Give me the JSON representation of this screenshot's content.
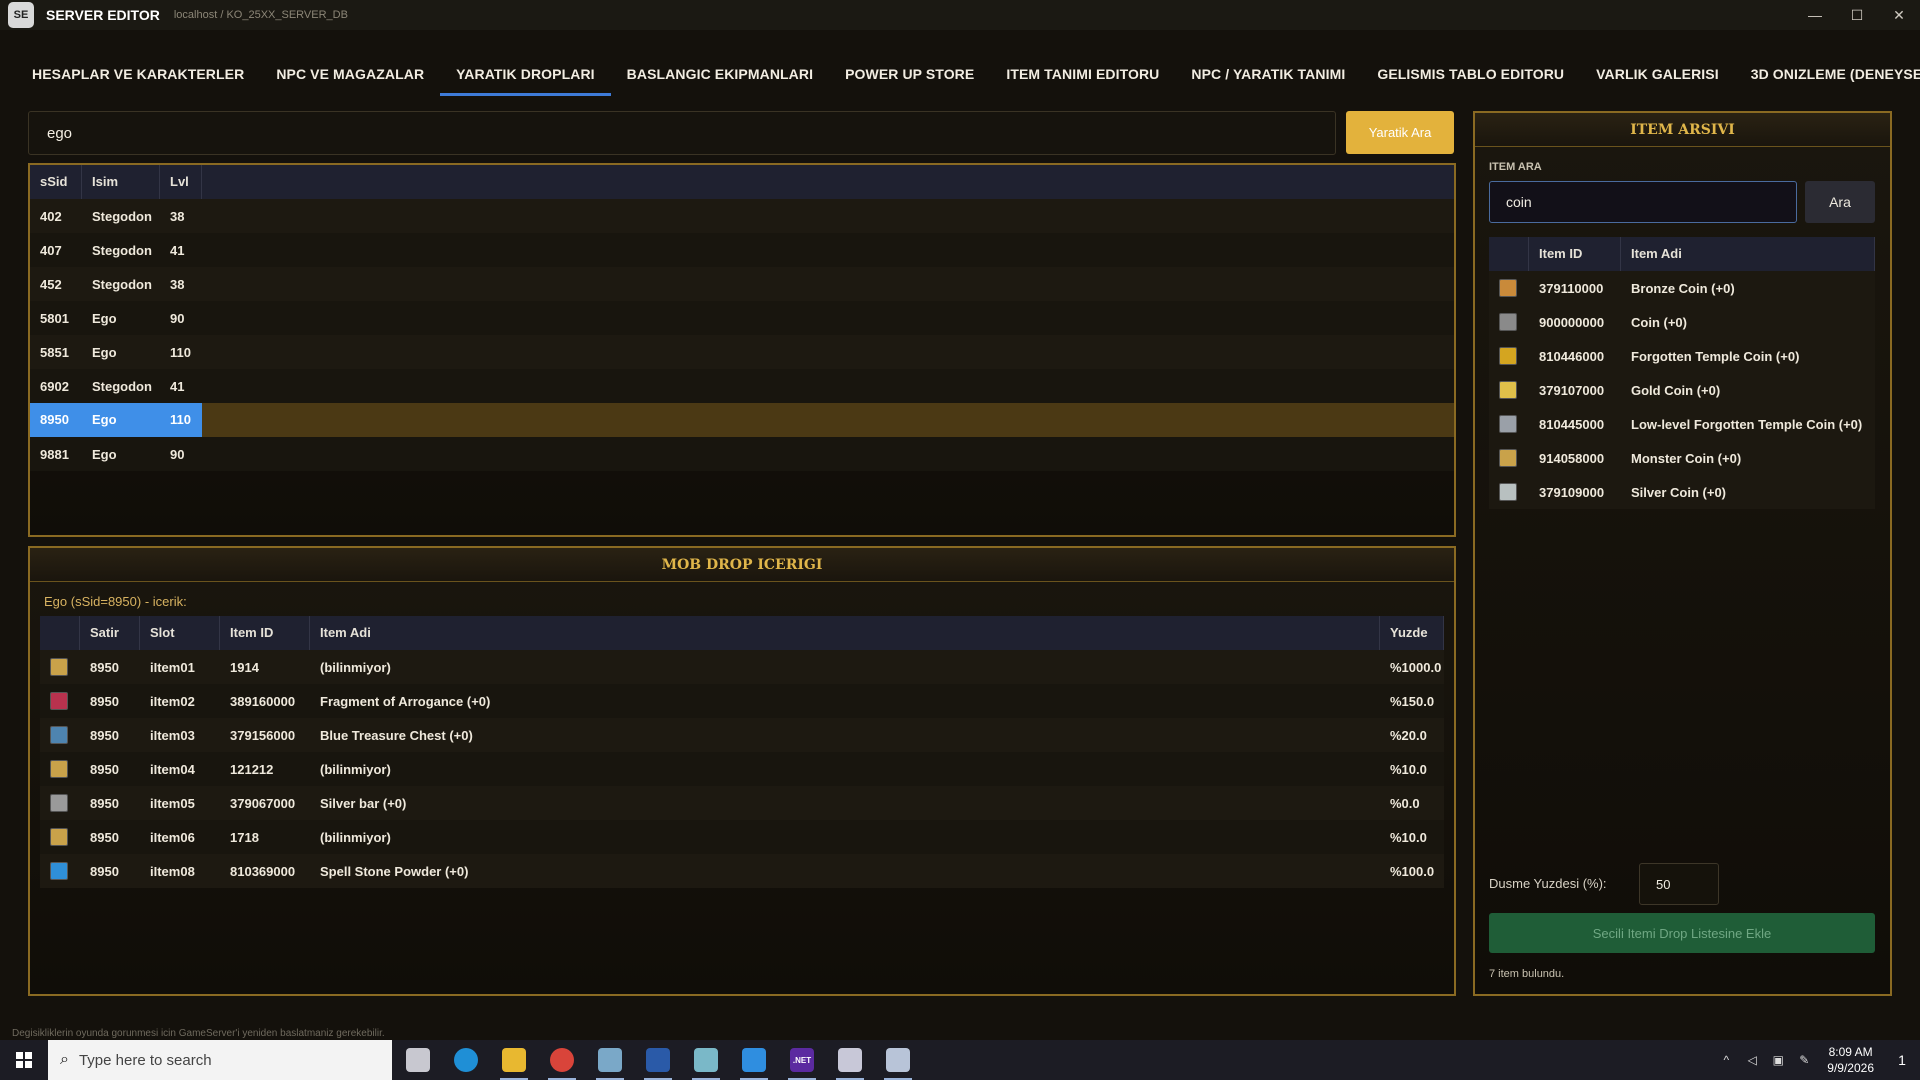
{
  "titlebar": {
    "badge": "SE",
    "title": "SERVER EDITOR",
    "path": "localhost / KO_25XX_SERVER_DB",
    "minimize": "—",
    "maximize": "☐",
    "close": "✕"
  },
  "tabs": [
    {
      "label": "HESAPLAR VE KARAKTERLER",
      "active": false
    },
    {
      "label": "NPC VE MAGAZALAR",
      "active": false
    },
    {
      "label": "YARATIK DROPLARI",
      "active": true
    },
    {
      "label": "BASLANGIC EKIPMANLARI",
      "active": false
    },
    {
      "label": "POWER UP STORE",
      "active": false
    },
    {
      "label": "ITEM TANIMI EDITORU",
      "active": false
    },
    {
      "label": "NPC / YARATIK TANIMI",
      "active": false
    },
    {
      "label": "GELISMIS TABLO EDITORU",
      "active": false
    },
    {
      "label": "VARLIK GALERISI",
      "active": false
    },
    {
      "label": "3D ONIZLEME (DENEYSEL)",
      "active": false
    }
  ],
  "mob_search": {
    "value": "ego",
    "button": "Yaratik Ara"
  },
  "mob_table": {
    "headers": [
      "sSid",
      "Isim",
      "Lvl"
    ],
    "rows": [
      {
        "sid": "402",
        "name": "Stegodon",
        "lvl": "38",
        "selected": false
      },
      {
        "sid": "407",
        "name": "Stegodon",
        "lvl": "41",
        "selected": false
      },
      {
        "sid": "452",
        "name": "Stegodon",
        "lvl": "38",
        "selected": false
      },
      {
        "sid": "5801",
        "name": "Ego",
        "lvl": "90",
        "selected": false
      },
      {
        "sid": "5851",
        "name": "Ego",
        "lvl": "110",
        "selected": false
      },
      {
        "sid": "6902",
        "name": "Stegodon",
        "lvl": "41",
        "selected": false
      },
      {
        "sid": "8950",
        "name": "Ego",
        "lvl": "110",
        "selected": true
      },
      {
        "sid": "9881",
        "name": "Ego",
        "lvl": "90",
        "selected": false
      }
    ]
  },
  "drop_panel": {
    "title": "MOB DROP ICERIGI",
    "caption": "Ego (sSid=8950) - icerik:",
    "headers": [
      "",
      "Satir",
      "Slot",
      "Item ID",
      "Item Adi",
      "Yuzde"
    ],
    "rows": [
      {
        "icon_color": "#c9a24a",
        "row": "8950",
        "slot": "iItem01",
        "item_id": "1914",
        "item_name": "(bilinmiyor)",
        "pct": "%1000.0"
      },
      {
        "icon_color": "#b8324e",
        "row": "8950",
        "slot": "iItem02",
        "item_id": "389160000",
        "item_name": "Fragment of Arrogance (+0)",
        "pct": "%150.0"
      },
      {
        "icon_color": "#4e84b0",
        "row": "8950",
        "slot": "iItem03",
        "item_id": "379156000",
        "item_name": "Blue Treasure Chest (+0)",
        "pct": "%20.0"
      },
      {
        "icon_color": "#c9a24a",
        "row": "8950",
        "slot": "iItem04",
        "item_id": "121212",
        "item_name": "(bilinmiyor)",
        "pct": "%10.0"
      },
      {
        "icon_color": "#9a9a9a",
        "row": "8950",
        "slot": "iItem05",
        "item_id": "379067000",
        "item_name": "Silver bar  (+0)",
        "pct": "%0.0"
      },
      {
        "icon_color": "#c9a24a",
        "row": "8950",
        "slot": "iItem06",
        "item_id": "1718",
        "item_name": "(bilinmiyor)",
        "pct": "%10.0"
      },
      {
        "icon_color": "#2f8fd8",
        "row": "8950",
        "slot": "iItem08",
        "item_id": "810369000",
        "item_name": "Spell Stone Powder (+0)",
        "pct": "%100.0"
      }
    ]
  },
  "archive": {
    "title": "ITEM ARSIVI",
    "search_label": "ITEM ARA",
    "search_value": "coin",
    "search_button": "Ara",
    "headers": [
      "",
      "Item ID",
      "Item Adi"
    ],
    "rows": [
      {
        "icon_color": "#c98a3a",
        "item_id": "379110000",
        "item_name": "Bronze Coin (+0)"
      },
      {
        "icon_color": "#8a8a8a",
        "item_id": "900000000",
        "item_name": "Coin (+0)"
      },
      {
        "icon_color": "#d4a520",
        "item_id": "810446000",
        "item_name": "Forgotten Temple Coin (+0)"
      },
      {
        "icon_color": "#e0c04a",
        "item_id": "379107000",
        "item_name": "Gold Coin (+0)"
      },
      {
        "icon_color": "#9aa0a8",
        "item_id": "810445000",
        "item_name": "Low-level Forgotten Temple Coin (+0)"
      },
      {
        "icon_color": "#c9a24a",
        "item_id": "914058000",
        "item_name": "Monster Coin (+0)"
      },
      {
        "icon_color": "#b8c0c0",
        "item_id": "379109000",
        "item_name": "Silver Coin (+0)"
      }
    ],
    "pct_label": "Dusme Yuzdesi (%):",
    "pct_value": "50",
    "add_button": "Secili Itemi Drop Listesine Ekle",
    "found_text": "7 item bulundu."
  },
  "footer_note": "Degisikliklerin oyunda gorunmesi icin GameServer'i yeniden baslatmaniz gerekebilir.",
  "taskbar": {
    "search_placeholder": "Type here to search",
    "apps": [
      {
        "name": "task-view-icon",
        "color": "#c8c8d0",
        "running": false
      },
      {
        "name": "edge-icon",
        "color": "#1f8fd6",
        "running": false
      },
      {
        "name": "file-explorer-icon",
        "color": "#e8b830",
        "running": true
      },
      {
        "name": "chrome-icon",
        "color": "#d9443a",
        "running": true
      },
      {
        "name": "paint-icon",
        "color": "#7aa8c8",
        "running": true
      },
      {
        "name": "powershell-icon",
        "color": "#2a5aa8",
        "running": true
      },
      {
        "name": "notepad-icon",
        "color": "#7ab8c8",
        "running": true
      },
      {
        "name": "vscode-icon",
        "color": "#2f8ee0",
        "running": true
      },
      {
        "name": "dotnet-icon",
        "color": "#5b2aa0",
        "running": true
      },
      {
        "name": "app-icon-1",
        "color": "#c8c8d8",
        "running": true
      },
      {
        "name": "app-icon-2",
        "color": "#b8c4d8",
        "running": true
      }
    ],
    "dotnet_label": ".NET",
    "time": "8:09 AM",
    "date": "9/9/2026",
    "notif_count": "1"
  },
  "colors": {
    "accent_gold": "#e3b23c",
    "selected_blue": "#3f8fe8",
    "active_tab": "#3e7bd9",
    "add_green": "#1f5d37"
  }
}
